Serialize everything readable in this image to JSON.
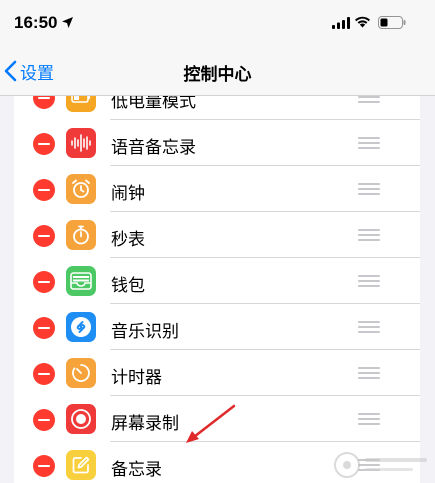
{
  "status_bar": {
    "time": "16:50"
  },
  "nav": {
    "back_label": "设置",
    "title": "控制中心"
  },
  "rows": [
    {
      "label": "低电量模式",
      "icon": "battery-icon",
      "color": "#f5a623"
    },
    {
      "label": "语音备忘录",
      "icon": "waveform-icon",
      "color": "#f03a3a"
    },
    {
      "label": "闹钟",
      "icon": "alarm-clock-icon",
      "color": "#f5a33a"
    },
    {
      "label": "秒表",
      "icon": "stopwatch-icon",
      "color": "#f5a33a"
    },
    {
      "label": "钱包",
      "icon": "wallet-icon",
      "color": "#4cc964"
    },
    {
      "label": "音乐识别",
      "icon": "shazam-icon",
      "color": "#1e8ef5"
    },
    {
      "label": "计时器",
      "icon": "timer-icon",
      "color": "#f5a33a"
    },
    {
      "label": "屏幕录制",
      "icon": "record-icon",
      "color": "#f03a3a"
    },
    {
      "label": "备忘录",
      "icon": "notes-icon",
      "color": "#f8cf3c"
    }
  ],
  "colors": {
    "accent": "#007aff",
    "delete": "#ff3b30",
    "annotation": "#e0292b"
  }
}
